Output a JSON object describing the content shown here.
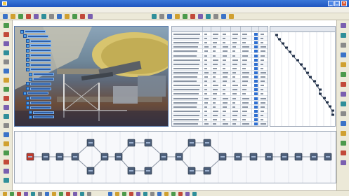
{
  "window": {
    "title": ""
  },
  "menu": {
    "items": [
      "",
      "",
      "",
      "",
      "",
      "",
      "",
      ""
    ]
  },
  "colors": {
    "titlebar": "#2b66cf",
    "spec_tree_node": "#2e5fa8",
    "pert_node": "#4d5f7a",
    "pert_start": "#c0392b",
    "gantt_link": "#23324a"
  },
  "icons": {
    "toolbar": [
      "open-icon",
      "save-icon",
      "print-icon",
      "cut-icon",
      "copy-icon",
      "paste-icon",
      "undo-icon",
      "redo-icon",
      "zoom-icon",
      "rotate-icon",
      "pan-icon",
      "fit-all-icon",
      "measure-icon",
      "section-icon",
      "render-icon",
      "simulate-icon",
      "play-icon",
      "stop-icon",
      "gantt-icon",
      "pert-icon",
      "resource-icon",
      "report-icon",
      "help-icon"
    ],
    "left": [
      "select-icon",
      "move-icon",
      "rotate-icon",
      "assembly-icon",
      "part-icon",
      "tool-icon",
      "robot-icon",
      "fixture-icon",
      "weld-icon",
      "path-icon",
      "clash-icon",
      "measure-icon",
      "annotate-icon",
      "camera-icon",
      "light-icon",
      "snapshot-icon",
      "export-icon",
      "settings-icon"
    ],
    "right": [
      "process-icon",
      "activity-icon",
      "resource-icon",
      "product-icon",
      "link-icon",
      "constraint-icon",
      "time-icon",
      "cost-icon",
      "report-icon",
      "filter-icon",
      "sort-icon",
      "expand-icon",
      "collapse-icon",
      "refresh-icon",
      "settings-icon"
    ]
  },
  "status": {
    "text": ""
  }
}
